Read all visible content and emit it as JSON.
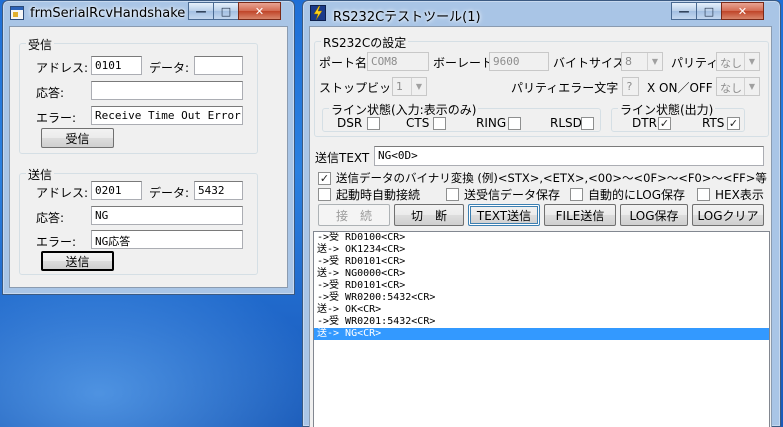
{
  "left_window": {
    "title": "frmSerialRcvHandshake",
    "controls": {
      "minimize": "—",
      "maximize": "□",
      "close": "✕"
    },
    "receive": {
      "legend": "受信",
      "address_label": "アドレス:",
      "address_value": "0101",
      "data_label": "データ:",
      "data_value": "",
      "response_label": "応答:",
      "response_value": "",
      "error_label": "エラー:",
      "error_value": "Receive Time Out Error!",
      "button": "受信"
    },
    "send": {
      "legend": "送信",
      "address_label": "アドレス:",
      "address_value": "0201",
      "data_label": "データ:",
      "data_value": "5432",
      "response_label": "応答:",
      "response_value": "NG",
      "error_label": "エラー:",
      "error_value": "NG応答",
      "button": "送信"
    }
  },
  "right_window": {
    "title": "RS232Cテストツール(1)",
    "controls": {
      "minimize": "—",
      "maximize": "□",
      "close": "✕"
    },
    "settings": {
      "legend": "RS232Cの設定",
      "port_label": "ポート名",
      "port_value": "COM8",
      "baud_label": "ボーレート",
      "baud_value": "9600",
      "bytesize_label": "バイトサイズ",
      "bytesize_value": "8",
      "parity_label": "パリティ",
      "parity_value": "なし",
      "stopbit_label": "ストップビット",
      "stopbit_value": "1",
      "parity_error_label": "パリティエラー文字",
      "parity_error_value": "?",
      "xonoff_label": "X ON／OFF",
      "xonoff_value": "なし"
    },
    "line_in": {
      "legend": "ライン状態(入力:表示のみ)",
      "items": [
        {
          "label": "DSR",
          "checked": false
        },
        {
          "label": "CTS",
          "checked": false
        },
        {
          "label": "RING",
          "checked": false
        },
        {
          "label": "RLSD",
          "checked": false
        }
      ]
    },
    "line_out": {
      "legend": "ライン状態(出力)",
      "items": [
        {
          "label": "DTR",
          "checked": true
        },
        {
          "label": "RTS",
          "checked": true
        }
      ]
    },
    "send_text_label": "送信TEXT",
    "send_text_value": "NG<0D>",
    "options": {
      "binary_convert": {
        "label": "送信データのバイナリ変換 (例)<STX>,<ETX>,<00>～<0F>～<F0>～<FF>等",
        "checked": true
      },
      "auto_connect": {
        "label": "起動時自動接続",
        "checked": false
      },
      "save_data": {
        "label": "送受信データ保存",
        "checked": false
      },
      "auto_log": {
        "label": "自動的にLOG保存",
        "checked": false
      },
      "hex_display": {
        "label": "HEX表示",
        "checked": false
      }
    },
    "buttons": {
      "connect": "接　続",
      "disconnect": "切　断",
      "text_send": "TEXT送信",
      "file_send": "FILE送信",
      "log_save": "LOG保存",
      "log_clear": "LOGクリア"
    },
    "log_lines": [
      "->受 RD0100<CR>",
      "送-> OK1234<CR>",
      "->受 RD0101<CR>",
      "送-> NG0000<CR>",
      "->受 RD0101<CR>",
      "->受 WR0200:5432<CR>",
      "送-> OK<CR>",
      "->受 WR0201:5432<CR>",
      "送-> NG<CR>"
    ],
    "selected_log_index": 8
  },
  "colors": {
    "desktop": "#2a80e0",
    "selection": "#3399ff",
    "close_button": "#c04428"
  }
}
